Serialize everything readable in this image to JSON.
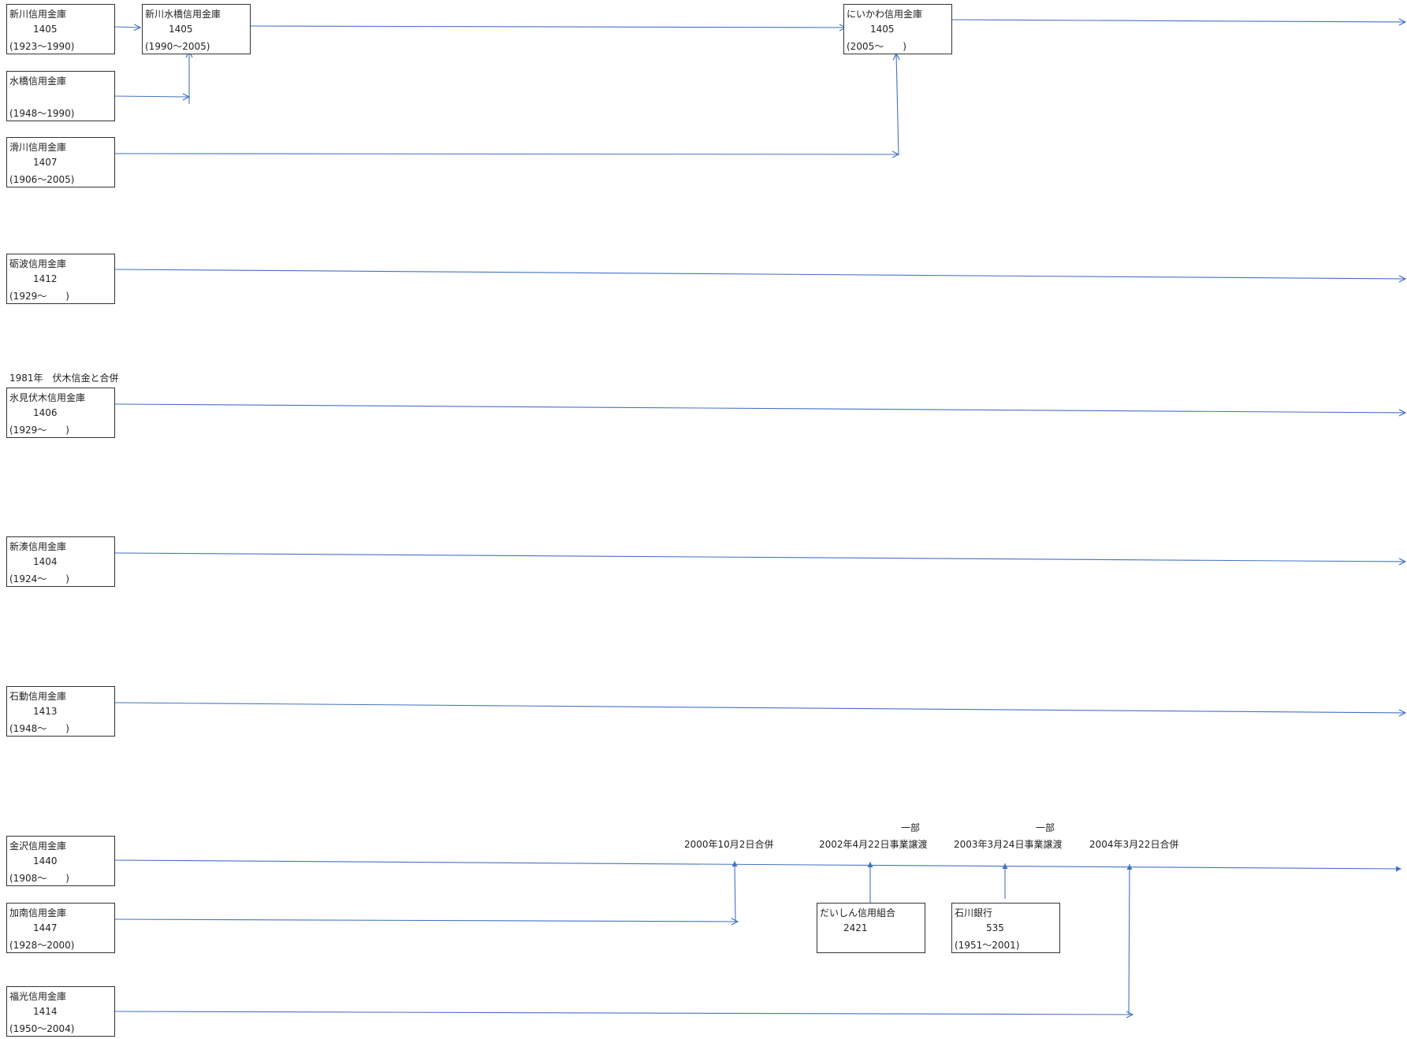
{
  "lineColor": "#4472c4",
  "boxBorderColor": "#333333",
  "nodes": [
    {
      "name": "新川信用金庫",
      "code": "1405",
      "period": "(1923～1990)"
    },
    {
      "name": "新川水橋信用金庫",
      "code": "1405",
      "period": "(1990～2005)"
    },
    {
      "name": "にいかわ信用金庫",
      "code": "1405",
      "period": "(2005～　　)"
    },
    {
      "name": "水橋信用金庫",
      "code": "",
      "period": "(1948～1990)"
    },
    {
      "name": "滑川信用金庫",
      "code": "1407",
      "period": "(1906～2005)"
    },
    {
      "name": "砺波信用金庫",
      "code": "1412",
      "period": "(1929～　　)"
    },
    {
      "name": "氷見伏木信用金庫",
      "code": "1406",
      "period": "(1929～　　)"
    },
    {
      "name": "新湊信用金庫",
      "code": "1404",
      "period": "(1924～　　)"
    },
    {
      "name": "石動信用金庫",
      "code": "1413",
      "period": "(1948～　　)"
    },
    {
      "name": "金沢信用金庫",
      "code": "1440",
      "period": "(1908～　　)"
    },
    {
      "name": "加南信用金庫",
      "code": "1447",
      "period": "(1928～2000)"
    },
    {
      "name": "福光信用金庫",
      "code": "1414",
      "period": "(1950～2004)"
    },
    {
      "name": "だいしん信用組合",
      "code": "2421",
      "period": ""
    },
    {
      "name": "石川銀行",
      "code": "535",
      "period": "(1951～2001)"
    }
  ],
  "annotations": {
    "himi_merger": "1981年　伏木信金と合併",
    "event_2000": "2000年10月2日合併",
    "event_2002": "2002年4月22日事業譲渡",
    "event_2002_part": "一部",
    "event_2003": "2003年3月24日事業譲渡",
    "event_2003_part": "一部",
    "event_2004": "2004年3月22日合併"
  }
}
